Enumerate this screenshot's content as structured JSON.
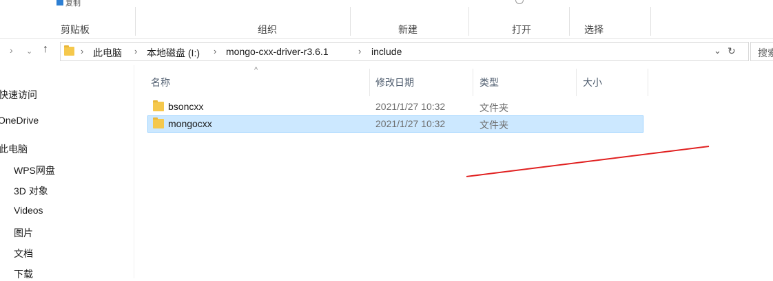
{
  "ribbon": {
    "stub_label": "复制",
    "groups": [
      "剪贴板",
      "组织",
      "新建",
      "打开",
      "选择"
    ]
  },
  "address": {
    "crumbs": [
      "此电脑",
      "本地磁盘 (I:)",
      "mongo-cxx-driver-r3.6.1",
      "include"
    ],
    "search_placeholder": "搜索"
  },
  "nav": {
    "items": [
      "快速访问",
      "OneDrive",
      "此电脑",
      "WPS网盘",
      "3D 对象",
      "Videos",
      "图片",
      "文档",
      "下载"
    ]
  },
  "columns": [
    "名称",
    "修改日期",
    "类型",
    "大小"
  ],
  "files": [
    {
      "name": "bsoncxx",
      "date": "2021/1/27 10:32",
      "type": "文件夹",
      "selected": false
    },
    {
      "name": "mongocxx",
      "date": "2021/1/27 10:32",
      "type": "文件夹",
      "selected": true
    }
  ],
  "colors": {
    "selection_bg": "#cce8ff",
    "folder": "#f5c84c",
    "annotation_line": "#e02020"
  }
}
